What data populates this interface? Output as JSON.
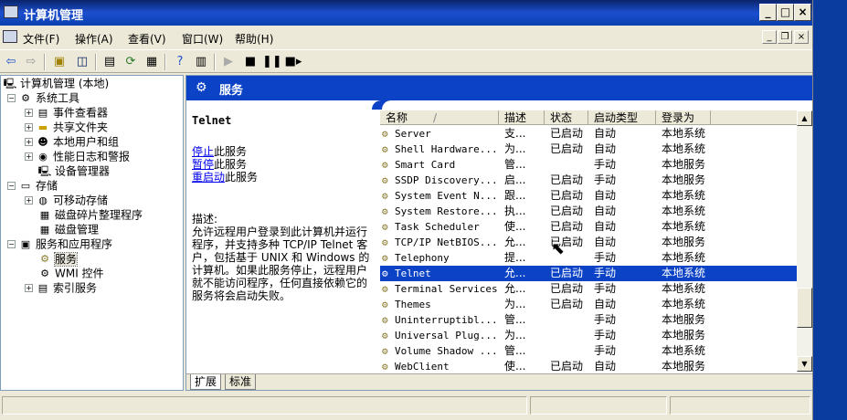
{
  "window": {
    "title": "计算机管理",
    "buttons": [
      "_",
      "□",
      "×"
    ]
  },
  "menubar": {
    "items": [
      "文件(F)",
      "操作(A)",
      "查看(V)",
      "窗口(W)",
      "帮助(H)"
    ],
    "mdi_buttons": [
      "_",
      "❐",
      "×"
    ]
  },
  "toolbar": {
    "icons": [
      "back-icon",
      "forward-icon",
      "up-folder-icon",
      "show-tree-icon",
      "properties-icon",
      "refresh-icon",
      "export-icon",
      "help-icon",
      "console-icon",
      "play-icon",
      "stop-icon",
      "pause-icon",
      "restart-icon"
    ]
  },
  "tree": {
    "nodes": [
      {
        "label": "计算机管理 (本地)",
        "icon": "computer-icon",
        "level": 0,
        "expander": ""
      },
      {
        "label": "系统工具",
        "icon": "tools-icon",
        "level": 1,
        "expander": "−"
      },
      {
        "label": "事件查看器",
        "icon": "event-viewer-icon",
        "level": 2,
        "expander": "+"
      },
      {
        "label": "共享文件夹",
        "icon": "shared-folder-icon",
        "level": 2,
        "expander": "+"
      },
      {
        "label": "本地用户和组",
        "icon": "users-icon",
        "level": 2,
        "expander": "+"
      },
      {
        "label": "性能日志和警报",
        "icon": "performance-icon",
        "level": 2,
        "expander": "+"
      },
      {
        "label": "设备管理器",
        "icon": "device-manager-icon",
        "level": 2,
        "expander": ""
      },
      {
        "label": "存储",
        "icon": "storage-icon",
        "level": 1,
        "expander": "−"
      },
      {
        "label": "可移动存储",
        "icon": "removable-storage-icon",
        "level": 2,
        "expander": "+"
      },
      {
        "label": "磁盘碎片整理程序",
        "icon": "defrag-icon",
        "level": 2,
        "expander": ""
      },
      {
        "label": "磁盘管理",
        "icon": "disk-management-icon",
        "level": 2,
        "expander": ""
      },
      {
        "label": "服务和应用程序",
        "icon": "services-apps-icon",
        "level": 1,
        "expander": "−"
      },
      {
        "label": "服务",
        "icon": "services-icon",
        "level": 2,
        "expander": "",
        "selected": true
      },
      {
        "label": "WMI 控件",
        "icon": "wmi-icon",
        "level": 2,
        "expander": ""
      },
      {
        "label": "索引服务",
        "icon": "indexing-icon",
        "level": 2,
        "expander": "+"
      }
    ]
  },
  "banner": {
    "title": "服务"
  },
  "description": {
    "service_name": "Telnet",
    "stop_link": "停止",
    "stop_suffix": "此服务",
    "pause_link": "暂停",
    "pause_suffix": "此服务",
    "restart_link": "重启动",
    "restart_suffix": "此服务",
    "label": "描述:",
    "body": "允许远程用户登录到此计算机并运行程序，并支持多种 TCP/IP Telnet 客户，包括基于 UNIX 和 Windows 的计算机。如果此服务停止，远程用户就不能访问程序，任何直接依赖它的服务将会启动失败。"
  },
  "list": {
    "columns": [
      "名称",
      "描述",
      "状态",
      "启动类型",
      "登录为"
    ],
    "sort_indicator": "/",
    "rows": [
      {
        "name": "Server",
        "desc": "支...",
        "status": "已启动",
        "startup": "自动",
        "logon": "本地系统"
      },
      {
        "name": "Shell Hardware...",
        "desc": "为...",
        "status": "已启动",
        "startup": "自动",
        "logon": "本地系统"
      },
      {
        "name": "Smart Card",
        "desc": "管...",
        "status": "",
        "startup": "手动",
        "logon": "本地服务"
      },
      {
        "name": "SSDP Discovery...",
        "desc": "启...",
        "status": "已启动",
        "startup": "手动",
        "logon": "本地服务"
      },
      {
        "name": "System Event N...",
        "desc": "跟...",
        "status": "已启动",
        "startup": "自动",
        "logon": "本地系统"
      },
      {
        "name": "System Restore...",
        "desc": "执...",
        "status": "已启动",
        "startup": "自动",
        "logon": "本地系统"
      },
      {
        "name": "Task Scheduler",
        "desc": "使...",
        "status": "已启动",
        "startup": "自动",
        "logon": "本地系统"
      },
      {
        "name": "TCP/IP NetBIOS...",
        "desc": "允...",
        "status": "已启动",
        "startup": "自动",
        "logon": "本地服务"
      },
      {
        "name": "Telephony",
        "desc": "提...",
        "status": "",
        "startup": "手动",
        "logon": "本地系统"
      },
      {
        "name": "Telnet",
        "desc": "允...",
        "status": "已启动",
        "startup": "手动",
        "logon": "本地系统",
        "selected": true
      },
      {
        "name": "Terminal Services",
        "desc": "允...",
        "status": "已启动",
        "startup": "手动",
        "logon": "本地系统"
      },
      {
        "name": "Themes",
        "desc": "为...",
        "status": "已启动",
        "startup": "自动",
        "logon": "本地系统"
      },
      {
        "name": "Uninterruptibl...",
        "desc": "管...",
        "status": "",
        "startup": "手动",
        "logon": "本地服务"
      },
      {
        "name": "Universal Plug...",
        "desc": "为...",
        "status": "",
        "startup": "手动",
        "logon": "本地服务"
      },
      {
        "name": "Volume Shadow ...",
        "desc": "管...",
        "status": "",
        "startup": "手动",
        "logon": "本地系统"
      },
      {
        "name": "WebClient",
        "desc": "使...",
        "status": "已启动",
        "startup": "自动",
        "logon": "本地服务"
      }
    ]
  },
  "tabs": [
    "扩展",
    "标准"
  ]
}
